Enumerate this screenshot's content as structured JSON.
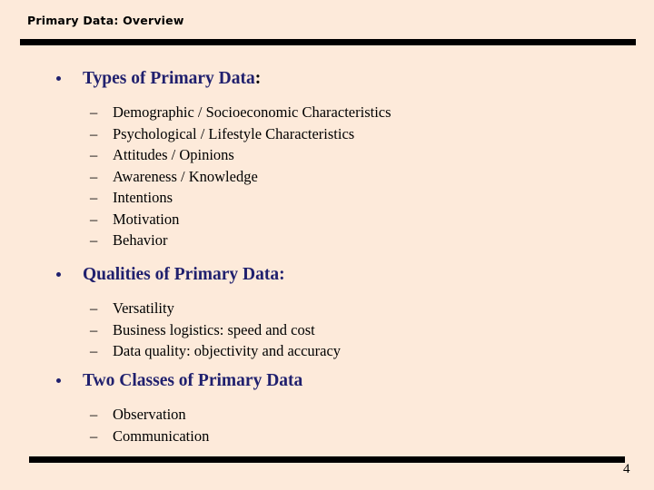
{
  "slide": {
    "title": "Primary Data: Overview",
    "page_number": "4",
    "colors": {
      "background": "#fdeada",
      "heading": "#20206e",
      "body_text": "#000000",
      "rule": "#000000"
    },
    "sections": [
      {
        "bullet_icon": "filled-circle-bullet",
        "heading": "Types of Primary Data",
        "heading_suffix": ":",
        "heading_suffix_color": "black",
        "items": [
          {
            "dash": "–",
            "text": "Demographic / Socioeconomic Characteristics"
          },
          {
            "dash": "–",
            "text": "Psychological / Lifestyle Characteristics"
          },
          {
            "dash": "–",
            "text": "Attitudes / Opinions"
          },
          {
            "dash": "–",
            "text": "Awareness / Knowledge"
          },
          {
            "dash": "–",
            "text": "Intentions"
          },
          {
            "dash": "–",
            "text": "Motivation"
          },
          {
            "dash": "–",
            "text": "Behavior"
          }
        ]
      },
      {
        "bullet_icon": "filled-circle-bullet",
        "heading": "Qualities of Primary Data",
        "heading_suffix": ":",
        "heading_suffix_color": "navy",
        "items": [
          {
            "dash": "–",
            "text": "Versatility"
          },
          {
            "dash": "–",
            "text": "Business logistics: speed and cost"
          },
          {
            "dash": "–",
            "text": "Data quality: objectivity and accuracy"
          }
        ]
      },
      {
        "bullet_icon": "filled-circle-bullet",
        "heading": "Two Classes of Primary Data",
        "heading_suffix": "",
        "heading_suffix_color": "navy",
        "items": [
          {
            "dash": "–",
            "text": "Observation"
          },
          {
            "dash": "–",
            "text": "Communication"
          }
        ]
      }
    ]
  }
}
